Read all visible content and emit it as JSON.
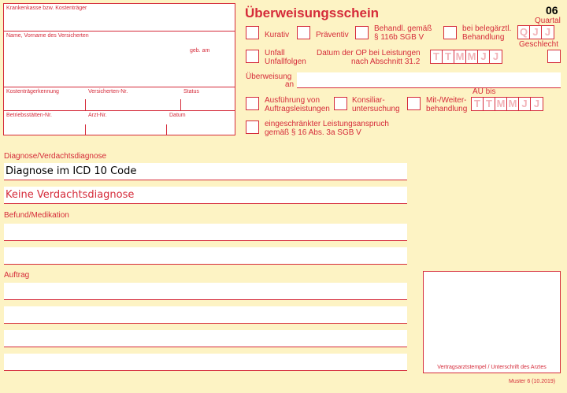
{
  "patient_block": {
    "kasse_label": "Krankenkasse bzw. Kostenträger",
    "name_label": "Name, Vorname des Versicherten",
    "geb_label": "geb. am",
    "kostentraeger_label": "Kostenträgerkennung",
    "versicherten_label": "Versicherten-Nr.",
    "status_label": "Status",
    "betrieb_label": "Betriebsstätten-Nr.",
    "arzt_label": "Arzt-Nr.",
    "datum_label": "Datum"
  },
  "form": {
    "title": "Überweisungsschein",
    "number": "06",
    "quartal_label": "Quartal",
    "quartal_boxes": [
      "Q",
      "J",
      "J"
    ],
    "geschlecht_label": "Geschlecht",
    "kurativ": "Kurativ",
    "praeventiv": "Präventiv",
    "behandl_116b_1": "Behandl. gemäß",
    "behandl_116b_2": "§ 116b SGB V",
    "beleg_1": "bei belegärztl.",
    "beleg_2": "Behandlung",
    "unfall_1": "Unfall",
    "unfall_2": "Unfallfolgen",
    "op_datum_1": "Datum der OP bei Leistungen",
    "op_datum_2": "nach Abschnitt 31.2",
    "date_boxes": [
      "T",
      "T",
      "M",
      "M",
      "J",
      "J"
    ],
    "ueberweisung_1": "Überweisung",
    "ueberweisung_2": "an",
    "ausfuehrung_1": "Ausführung von",
    "ausfuehrung_2": "Auftragsleistungen",
    "konsiliar_1": "Konsiliar-",
    "konsiliar_2": "untersuchung",
    "mitweiter_1": "Mit-/Weiter-",
    "mitweiter_2": "behandlung",
    "au_bis": "AU bis",
    "eingeschraenkt_1": "eingeschränkter Leistungsanspruch",
    "eingeschraenkt_2": "gemäß § 16 Abs. 3a SGB V"
  },
  "diagnose": {
    "label": "Diagnose/Verdachtsdiagnose",
    "line1": "Diagnose im ICD 10 Code",
    "line2": "Keine Verdachtsdiagnose"
  },
  "befund": {
    "label": "Befund/Medikation"
  },
  "auftrag": {
    "label": "Auftrag"
  },
  "stamp": {
    "label": "Vertragsarztstempel / Unterschrift des Arztes"
  },
  "footer": {
    "muster": "Muster 6 (10.2019)"
  }
}
